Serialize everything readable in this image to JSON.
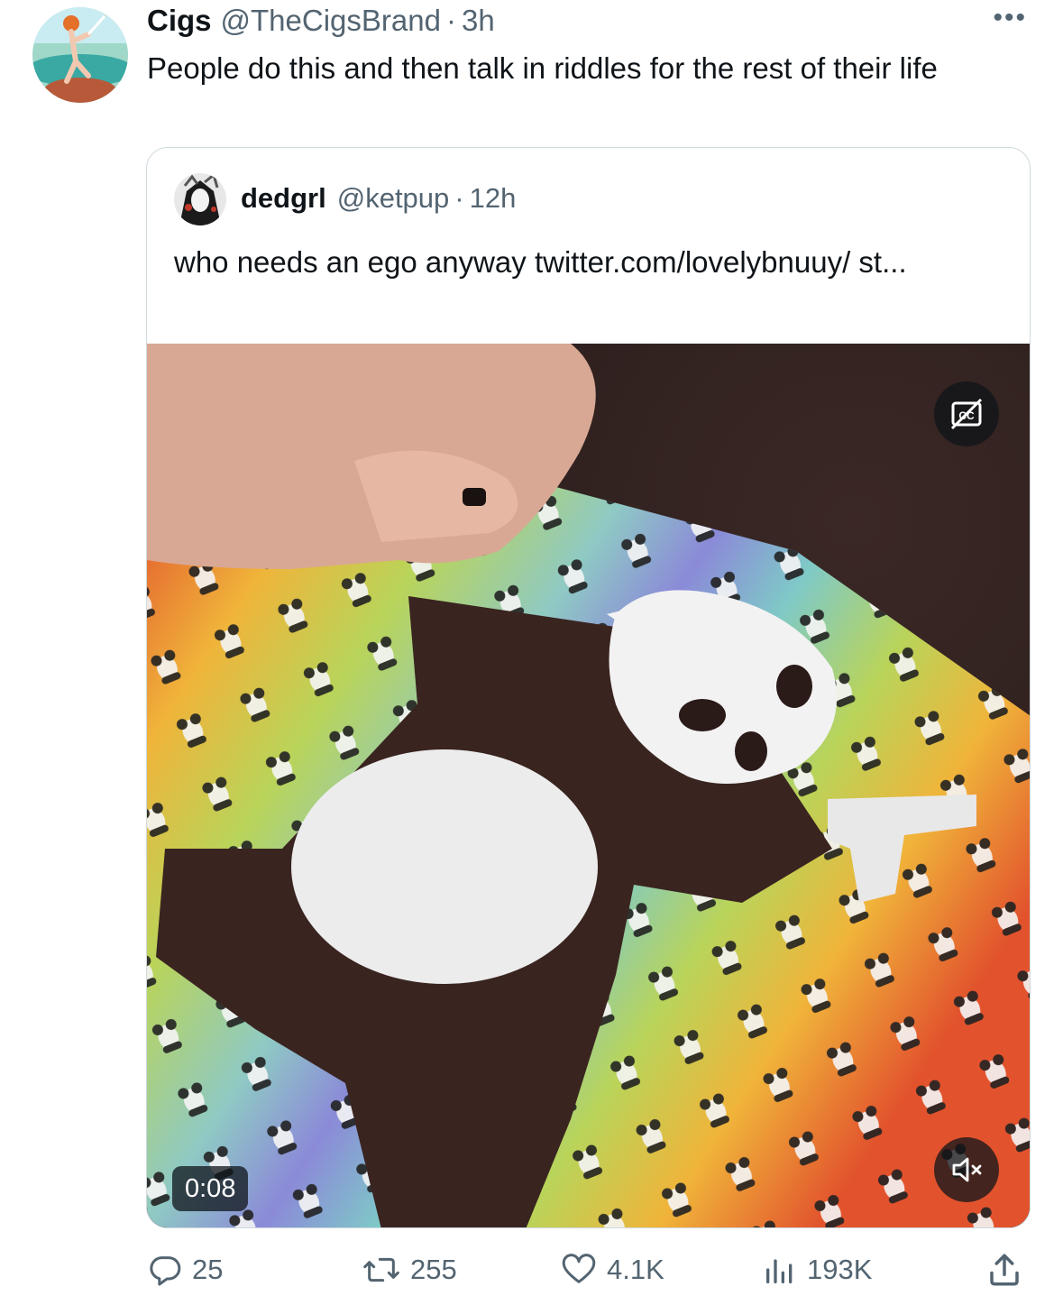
{
  "tweet": {
    "author_name": "Cigs",
    "author_handle": "@TheCigsBrand",
    "separator": "·",
    "time": "3h",
    "more_label": "•••",
    "text": "People do this and then talk in riddles for the rest of their life"
  },
  "quote": {
    "author_name": "dedgrl",
    "author_handle": "@ketpup",
    "separator": "·",
    "time": "12h",
    "text": "who needs an ego anyway twitter.com/lovelybnuuy/ st...",
    "video": {
      "duration": "0:08",
      "captions_icon": "closed-captions-off-icon",
      "mute_icon": "volume-muted-icon"
    }
  },
  "actions": {
    "replies": "25",
    "reposts": "255",
    "likes": "4.1K",
    "views": "193K"
  },
  "colors": {
    "text_primary": "#0f1419",
    "text_secondary": "#536471",
    "border": "#cfd9de"
  }
}
